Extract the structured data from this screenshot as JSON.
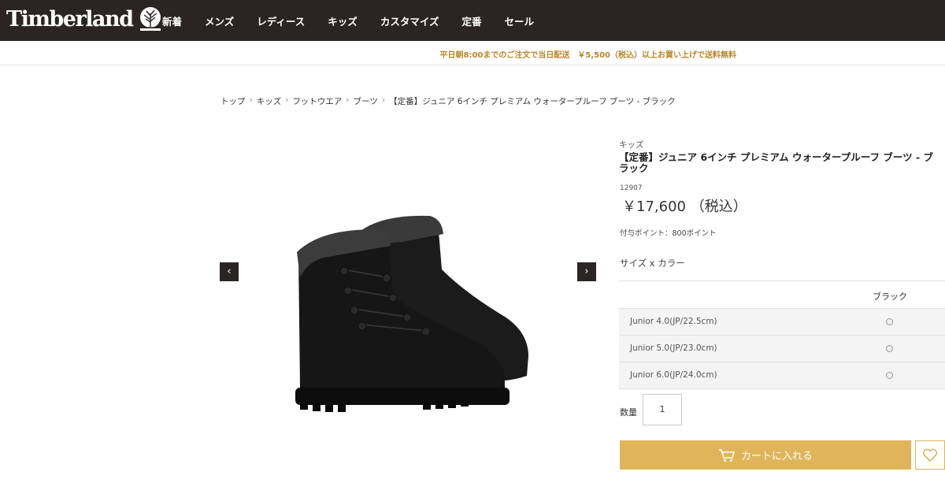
{
  "header": {
    "logo": "Timberland",
    "nav": [
      "新着",
      "メンズ",
      "レディース",
      "キッズ",
      "カスタマイズ",
      "定番",
      "セール"
    ]
  },
  "notice": "平日朝8:00までのご注文で当日配送　￥5,500（税込）以上お買い上げで送料無料",
  "breadcrumb": [
    "トップ",
    "キッズ",
    "フットウエア",
    "ブーツ",
    "【定番】ジュニア 6インチ プレミアム ウォータープルーフ ブーツ - ブラック"
  ],
  "gallery": {
    "prev": "‹",
    "next": "›"
  },
  "product": {
    "category": "キッズ",
    "title": "【定番】ジュニア 6インチ プレミアム ウォータープルーフ ブーツ - ブラック",
    "sku": "12907",
    "price": "￥17,600 （税込）",
    "points": "付与ポイント：800ポイント",
    "size_label": "サイズ x カラー",
    "color_header": "ブラック",
    "sizes": [
      "Junior 4.0(JP/22.5cm)",
      "Junior 5.0(JP/23.0cm)",
      "Junior 6.0(JP/24.0cm)"
    ],
    "qty_label": "数量",
    "qty_value": "1",
    "cart_label": "カートに入れる"
  },
  "colors": {
    "header_bg": "#2a2523",
    "accent": "#e0b55a",
    "notice": "#b9862c"
  }
}
